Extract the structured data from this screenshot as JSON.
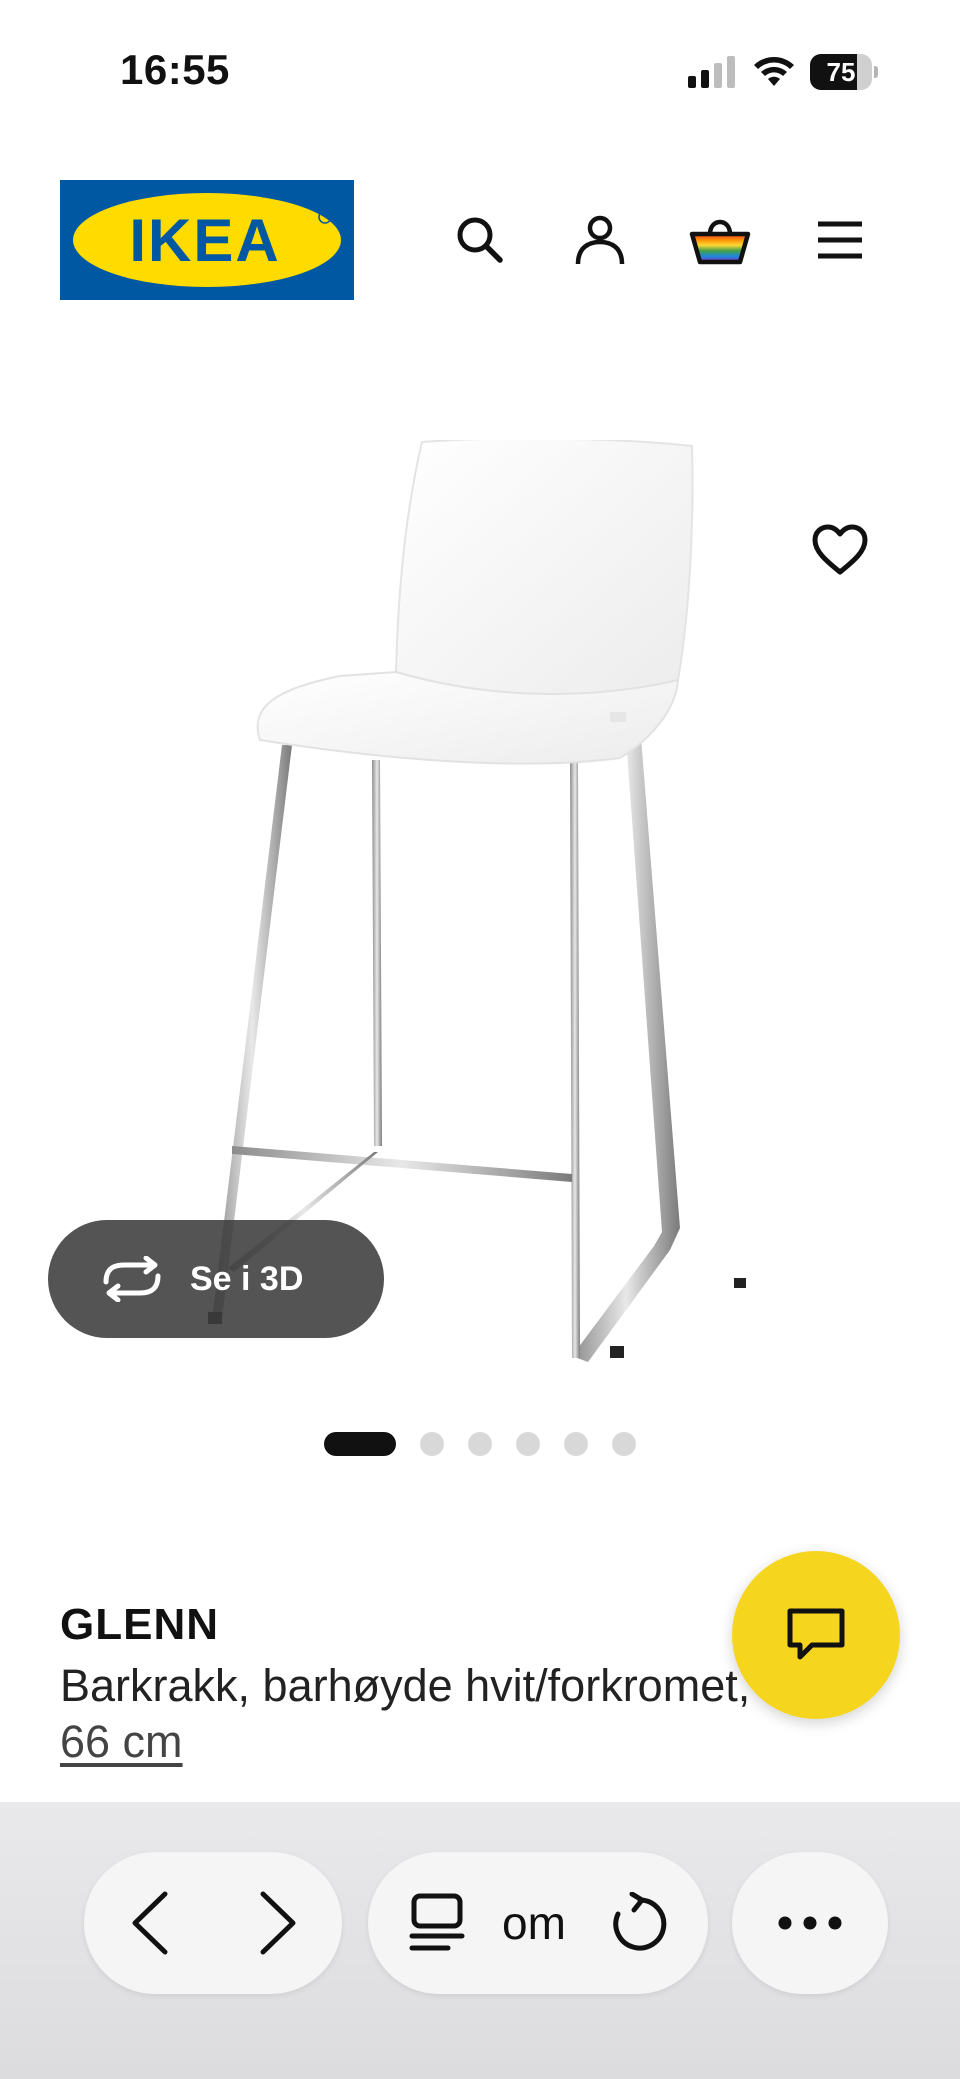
{
  "status_bar": {
    "time": "16:55",
    "battery_level": "75",
    "battery_fraction": 0.75
  },
  "header": {
    "logo_text": "IKEA",
    "icons": [
      "search-icon",
      "profile-icon",
      "cart-icon",
      "menu-icon"
    ],
    "brand_blue": "#0058a3",
    "brand_yellow": "#ffdb00"
  },
  "gallery": {
    "view_3d_label": "Se i 3D",
    "slide_count": 6,
    "active_slide": 1
  },
  "product": {
    "name": "GLENN",
    "description": "Barkrakk, barhøyde hvit/forkromet,",
    "size": "66 cm"
  },
  "chat": {
    "accent": "#f6d51f"
  },
  "browser_toolbar": {
    "address_text": "om"
  }
}
